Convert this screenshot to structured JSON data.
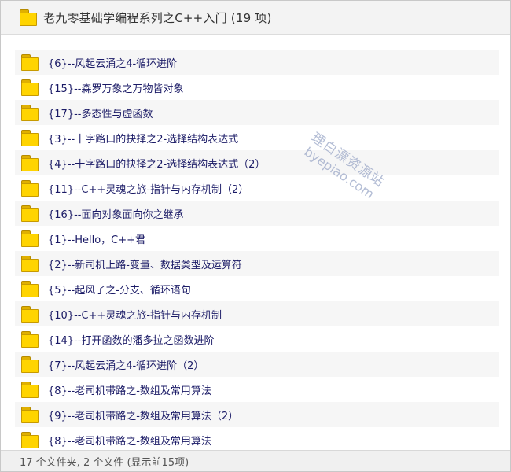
{
  "window": {
    "title": "老九零基础学编程系列之C++入门 (19 项)",
    "icon": "folder-icon"
  },
  "items": [
    {
      "label": "{6}--风起云涌之4-循环进阶"
    },
    {
      "label": "{15}--森罗万象之万物皆对象"
    },
    {
      "label": "{17}--多态性与虚函数"
    },
    {
      "label": "{3}--十字路口的抉择之2-选择结构表达式"
    },
    {
      "label": "{4}--十字路口的抉择之2-选择结构表达式（2）"
    },
    {
      "label": "{11}--C++灵魂之旅-指针与内存机制（2）"
    },
    {
      "label": "{16}--面向对象面向你之继承"
    },
    {
      "label": "{1}--Hello，C++君"
    },
    {
      "label": "{2}--新司机上路-变量、数据类型及运算符"
    },
    {
      "label": "{5}--起风了之-分支、循环语句"
    },
    {
      "label": "{10}--C++灵魂之旅-指针与内存机制"
    },
    {
      "label": "{14}--打开函数的潘多拉之函数进阶"
    },
    {
      "label": "{7}--风起云涌之4-循环进阶（2）"
    },
    {
      "label": "{8}--老司机带路之-数组及常用算法"
    },
    {
      "label": "{9}--老司机带路之-数组及常用算法（2）"
    },
    {
      "label": "{8}--老司机带路之-数组及常用算法"
    }
  ],
  "status": {
    "text": "17 个文件夹, 2 个文件 (显示前15项)"
  },
  "watermark": {
    "line1": "理白漂资源站",
    "line2": "byepiao.com"
  },
  "colors": {
    "folder_fill": "#ffd400",
    "item_text": "#1a1a66",
    "header_bg": "#f3f3f3"
  }
}
